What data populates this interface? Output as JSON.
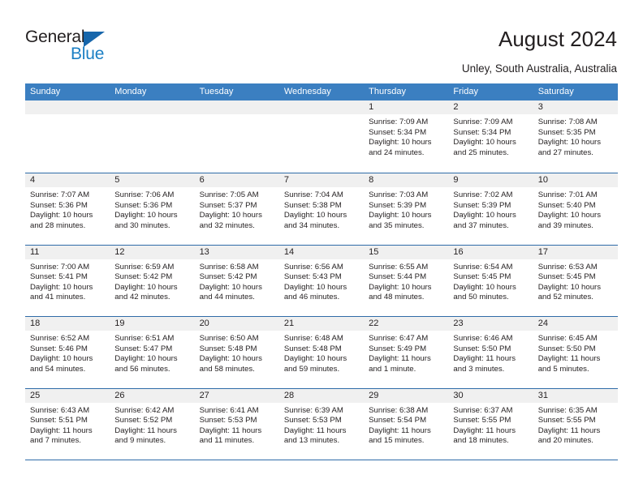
{
  "branding": {
    "name_part1": "General",
    "name_part2": "Blue",
    "logo_triangle_color": "#1766AB",
    "blue_text_color": "#1B7FC4"
  },
  "header": {
    "title": "August 2024",
    "location": "Unley, South Australia, Australia"
  },
  "theme": {
    "weekday_header_bg": "#3B7FC1",
    "weekday_header_text": "#FFFFFF",
    "daynum_band_bg": "#F0F0F0",
    "row_divider": "#2F6CA8",
    "body_text": "#231F20"
  },
  "calendar": {
    "weekdays": [
      "Sunday",
      "Monday",
      "Tuesday",
      "Wednesday",
      "Thursday",
      "Friday",
      "Saturday"
    ],
    "weeks": [
      [
        {
          "day": "",
          "empty": true
        },
        {
          "day": "",
          "empty": true
        },
        {
          "day": "",
          "empty": true
        },
        {
          "day": "",
          "empty": true
        },
        {
          "day": "1",
          "sunrise": "Sunrise: 7:09 AM",
          "sunset": "Sunset: 5:34 PM",
          "daylight_line1": "Daylight: 10 hours",
          "daylight_line2": "and 24 minutes."
        },
        {
          "day": "2",
          "sunrise": "Sunrise: 7:09 AM",
          "sunset": "Sunset: 5:34 PM",
          "daylight_line1": "Daylight: 10 hours",
          "daylight_line2": "and 25 minutes."
        },
        {
          "day": "3",
          "sunrise": "Sunrise: 7:08 AM",
          "sunset": "Sunset: 5:35 PM",
          "daylight_line1": "Daylight: 10 hours",
          "daylight_line2": "and 27 minutes."
        }
      ],
      [
        {
          "day": "4",
          "sunrise": "Sunrise: 7:07 AM",
          "sunset": "Sunset: 5:36 PM",
          "daylight_line1": "Daylight: 10 hours",
          "daylight_line2": "and 28 minutes."
        },
        {
          "day": "5",
          "sunrise": "Sunrise: 7:06 AM",
          "sunset": "Sunset: 5:36 PM",
          "daylight_line1": "Daylight: 10 hours",
          "daylight_line2": "and 30 minutes."
        },
        {
          "day": "6",
          "sunrise": "Sunrise: 7:05 AM",
          "sunset": "Sunset: 5:37 PM",
          "daylight_line1": "Daylight: 10 hours",
          "daylight_line2": "and 32 minutes."
        },
        {
          "day": "7",
          "sunrise": "Sunrise: 7:04 AM",
          "sunset": "Sunset: 5:38 PM",
          "daylight_line1": "Daylight: 10 hours",
          "daylight_line2": "and 34 minutes."
        },
        {
          "day": "8",
          "sunrise": "Sunrise: 7:03 AM",
          "sunset": "Sunset: 5:39 PM",
          "daylight_line1": "Daylight: 10 hours",
          "daylight_line2": "and 35 minutes."
        },
        {
          "day": "9",
          "sunrise": "Sunrise: 7:02 AM",
          "sunset": "Sunset: 5:39 PM",
          "daylight_line1": "Daylight: 10 hours",
          "daylight_line2": "and 37 minutes."
        },
        {
          "day": "10",
          "sunrise": "Sunrise: 7:01 AM",
          "sunset": "Sunset: 5:40 PM",
          "daylight_line1": "Daylight: 10 hours",
          "daylight_line2": "and 39 minutes."
        }
      ],
      [
        {
          "day": "11",
          "sunrise": "Sunrise: 7:00 AM",
          "sunset": "Sunset: 5:41 PM",
          "daylight_line1": "Daylight: 10 hours",
          "daylight_line2": "and 41 minutes."
        },
        {
          "day": "12",
          "sunrise": "Sunrise: 6:59 AM",
          "sunset": "Sunset: 5:42 PM",
          "daylight_line1": "Daylight: 10 hours",
          "daylight_line2": "and 42 minutes."
        },
        {
          "day": "13",
          "sunrise": "Sunrise: 6:58 AM",
          "sunset": "Sunset: 5:42 PM",
          "daylight_line1": "Daylight: 10 hours",
          "daylight_line2": "and 44 minutes."
        },
        {
          "day": "14",
          "sunrise": "Sunrise: 6:56 AM",
          "sunset": "Sunset: 5:43 PM",
          "daylight_line1": "Daylight: 10 hours",
          "daylight_line2": "and 46 minutes."
        },
        {
          "day": "15",
          "sunrise": "Sunrise: 6:55 AM",
          "sunset": "Sunset: 5:44 PM",
          "daylight_line1": "Daylight: 10 hours",
          "daylight_line2": "and 48 minutes."
        },
        {
          "day": "16",
          "sunrise": "Sunrise: 6:54 AM",
          "sunset": "Sunset: 5:45 PM",
          "daylight_line1": "Daylight: 10 hours",
          "daylight_line2": "and 50 minutes."
        },
        {
          "day": "17",
          "sunrise": "Sunrise: 6:53 AM",
          "sunset": "Sunset: 5:45 PM",
          "daylight_line1": "Daylight: 10 hours",
          "daylight_line2": "and 52 minutes."
        }
      ],
      [
        {
          "day": "18",
          "sunrise": "Sunrise: 6:52 AM",
          "sunset": "Sunset: 5:46 PM",
          "daylight_line1": "Daylight: 10 hours",
          "daylight_line2": "and 54 minutes."
        },
        {
          "day": "19",
          "sunrise": "Sunrise: 6:51 AM",
          "sunset": "Sunset: 5:47 PM",
          "daylight_line1": "Daylight: 10 hours",
          "daylight_line2": "and 56 minutes."
        },
        {
          "day": "20",
          "sunrise": "Sunrise: 6:50 AM",
          "sunset": "Sunset: 5:48 PM",
          "daylight_line1": "Daylight: 10 hours",
          "daylight_line2": "and 58 minutes."
        },
        {
          "day": "21",
          "sunrise": "Sunrise: 6:48 AM",
          "sunset": "Sunset: 5:48 PM",
          "daylight_line1": "Daylight: 10 hours",
          "daylight_line2": "and 59 minutes."
        },
        {
          "day": "22",
          "sunrise": "Sunrise: 6:47 AM",
          "sunset": "Sunset: 5:49 PM",
          "daylight_line1": "Daylight: 11 hours",
          "daylight_line2": "and 1 minute."
        },
        {
          "day": "23",
          "sunrise": "Sunrise: 6:46 AM",
          "sunset": "Sunset: 5:50 PM",
          "daylight_line1": "Daylight: 11 hours",
          "daylight_line2": "and 3 minutes."
        },
        {
          "day": "24",
          "sunrise": "Sunrise: 6:45 AM",
          "sunset": "Sunset: 5:50 PM",
          "daylight_line1": "Daylight: 11 hours",
          "daylight_line2": "and 5 minutes."
        }
      ],
      [
        {
          "day": "25",
          "sunrise": "Sunrise: 6:43 AM",
          "sunset": "Sunset: 5:51 PM",
          "daylight_line1": "Daylight: 11 hours",
          "daylight_line2": "and 7 minutes."
        },
        {
          "day": "26",
          "sunrise": "Sunrise: 6:42 AM",
          "sunset": "Sunset: 5:52 PM",
          "daylight_line1": "Daylight: 11 hours",
          "daylight_line2": "and 9 minutes."
        },
        {
          "day": "27",
          "sunrise": "Sunrise: 6:41 AM",
          "sunset": "Sunset: 5:53 PM",
          "daylight_line1": "Daylight: 11 hours",
          "daylight_line2": "and 11 minutes."
        },
        {
          "day": "28",
          "sunrise": "Sunrise: 6:39 AM",
          "sunset": "Sunset: 5:53 PM",
          "daylight_line1": "Daylight: 11 hours",
          "daylight_line2": "and 13 minutes."
        },
        {
          "day": "29",
          "sunrise": "Sunrise: 6:38 AM",
          "sunset": "Sunset: 5:54 PM",
          "daylight_line1": "Daylight: 11 hours",
          "daylight_line2": "and 15 minutes."
        },
        {
          "day": "30",
          "sunrise": "Sunrise: 6:37 AM",
          "sunset": "Sunset: 5:55 PM",
          "daylight_line1": "Daylight: 11 hours",
          "daylight_line2": "and 18 minutes."
        },
        {
          "day": "31",
          "sunrise": "Sunrise: 6:35 AM",
          "sunset": "Sunset: 5:55 PM",
          "daylight_line1": "Daylight: 11 hours",
          "daylight_line2": "and 20 minutes."
        }
      ]
    ]
  }
}
